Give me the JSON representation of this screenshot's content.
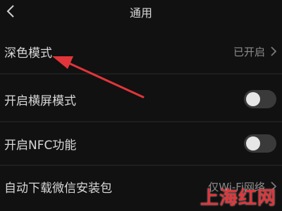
{
  "header": {
    "title": "通用"
  },
  "icons": {
    "back": "chevron-left-icon",
    "chevron": "chevron-right-icon"
  },
  "rows": [
    {
      "label": "深色模式",
      "value": "已开启"
    },
    {
      "label": "开启横屏模式",
      "toggle_on": false
    },
    {
      "label": "开启NFC功能",
      "toggle_on": false
    },
    {
      "label": "自动下载微信安装包",
      "value": "仅Wi-Fi网络"
    }
  ],
  "colors": {
    "background": "#111111",
    "annotation_arrow": "#e2353a",
    "watermark": "#e2353a"
  },
  "watermark": {
    "text": "上海红网"
  }
}
